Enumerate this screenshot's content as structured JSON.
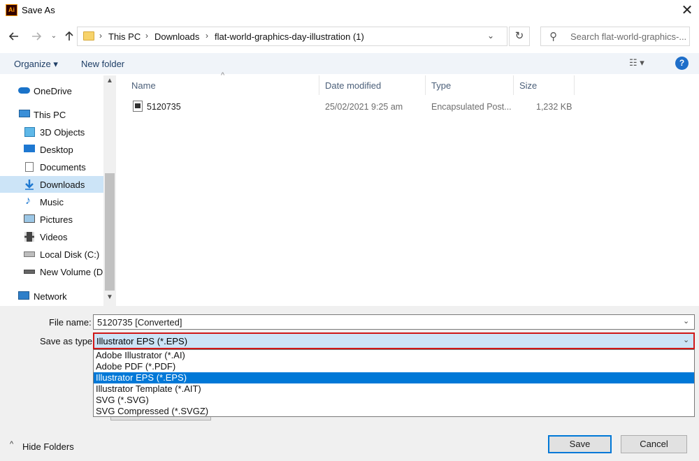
{
  "window": {
    "title": "Save As",
    "app_logo": "Ai"
  },
  "nav": {
    "back_icon": "arrow-left-icon",
    "forward_icon": "arrow-right-icon",
    "recent_icon": "chevron-down-icon",
    "up_icon": "arrow-up-icon"
  },
  "address": {
    "breadcrumbs": [
      "This PC",
      "Downloads",
      "flat-world-graphics-day-illustration (1)"
    ]
  },
  "search": {
    "placeholder": "Search flat-world-graphics-..."
  },
  "toolbar": {
    "organize": "Organize ▾",
    "new_folder": "New folder",
    "view": "☷ ▾",
    "help": "?"
  },
  "sidebar": {
    "items": [
      {
        "label": "OneDrive",
        "icon": "cloud-icon"
      },
      {
        "label": "This PC",
        "icon": "computer-icon"
      },
      {
        "label": "3D Objects",
        "icon": "cube-icon"
      },
      {
        "label": "Desktop",
        "icon": "desktop-icon"
      },
      {
        "label": "Documents",
        "icon": "document-icon"
      },
      {
        "label": "Downloads",
        "icon": "download-icon"
      },
      {
        "label": "Music",
        "icon": "music-icon"
      },
      {
        "label": "Pictures",
        "icon": "pictures-icon"
      },
      {
        "label": "Videos",
        "icon": "video-icon"
      },
      {
        "label": "Local Disk (C:)",
        "icon": "drive-icon"
      },
      {
        "label": "New Volume (D:",
        "icon": "drive-icon"
      },
      {
        "label": "Network",
        "icon": "network-icon"
      }
    ]
  },
  "columns": {
    "name": "Name",
    "date": "Date modified",
    "type": "Type",
    "size": "Size"
  },
  "files": [
    {
      "name": "5120735",
      "date": "25/02/2021 9:25 am",
      "type": "Encapsulated Post...",
      "size": "1,232 KB"
    }
  ],
  "form": {
    "file_name_label": "File name:",
    "file_name_value": "5120735 [Converted]",
    "save_type_label": "Save as type:",
    "save_type_value": "Illustrator EPS (*.EPS)",
    "type_options": [
      "Adobe Illustrator (*.AI)",
      "Adobe PDF (*.PDF)",
      "Illustrator EPS (*.EPS)",
      "Illustrator Template (*.AIT)",
      "SVG (*.SVG)",
      "SVG Compressed (*.SVGZ)"
    ],
    "selected_option_index": 2
  },
  "footer": {
    "hide_folders": "Hide Folders",
    "save": "Save",
    "cancel": "Cancel"
  },
  "colors": {
    "selection": "#0078d7",
    "highlight": "#cce4f7",
    "annotation_border": "#d01818"
  }
}
